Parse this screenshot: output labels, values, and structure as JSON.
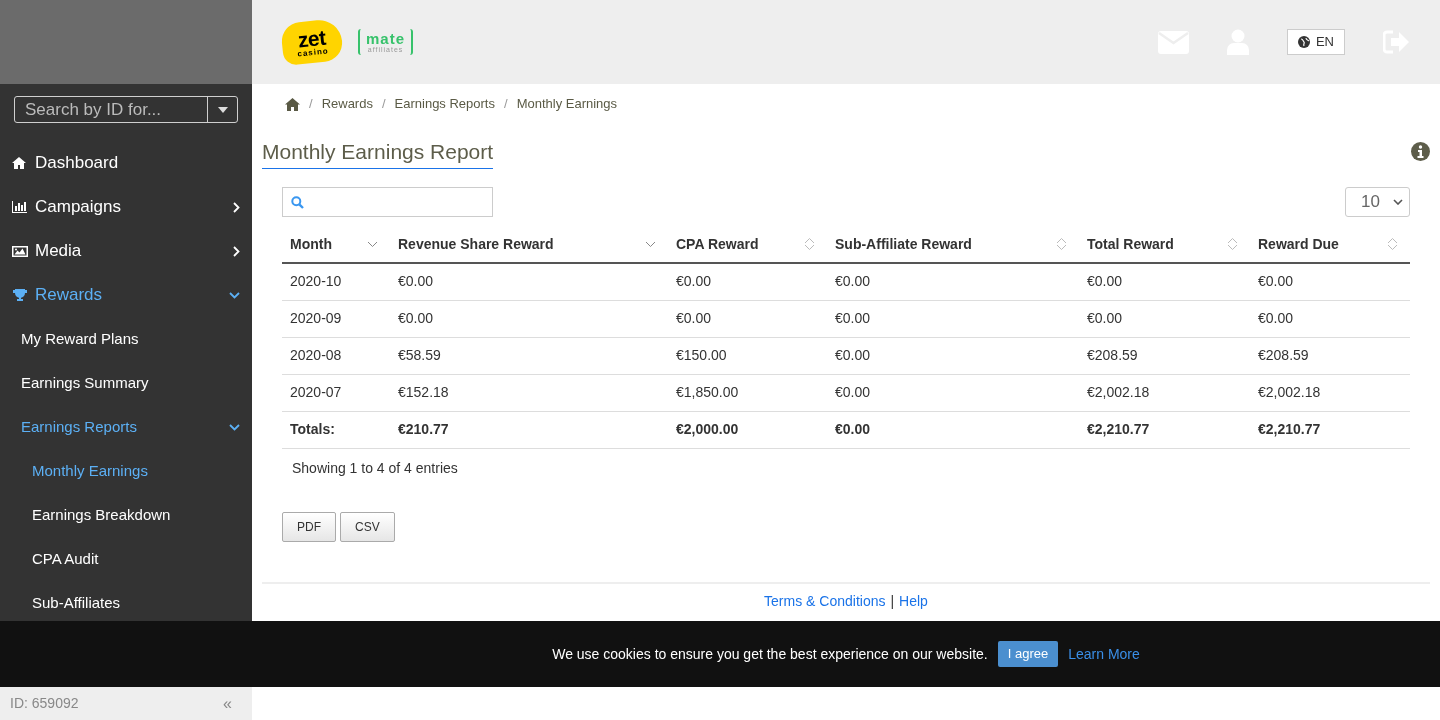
{
  "sidebar": {
    "search": {
      "placeholder": "Search by ID for..."
    },
    "items": [
      {
        "label": "Dashboard",
        "selected": false
      },
      {
        "label": "Campaigns",
        "selected": false,
        "expanded": false
      },
      {
        "label": "Media",
        "selected": false,
        "expanded": false
      },
      {
        "label": "Rewards",
        "selected": true,
        "expanded": true,
        "children": [
          {
            "label": "My Reward Plans",
            "selected": false
          },
          {
            "label": "Earnings Summary",
            "selected": false
          },
          {
            "label": "Earnings Reports",
            "selected": true,
            "expanded": true,
            "children": [
              {
                "label": "Monthly Earnings",
                "selected": true
              },
              {
                "label": "Earnings Breakdown",
                "selected": false
              },
              {
                "label": "CPA Audit",
                "selected": false
              },
              {
                "label": "Sub-Affiliates",
                "selected": false
              }
            ]
          }
        ]
      }
    ],
    "footer": {
      "user_id": "ID: 659092",
      "collapse": "«"
    }
  },
  "header": {
    "logo": {
      "word": "zet",
      "subword": "casino"
    },
    "partner_logo": {
      "word": "mate",
      "subword": "affiliates"
    },
    "language": "EN"
  },
  "breadcrumb": {
    "separator": "/",
    "items": [
      "Rewards",
      "Earnings Reports",
      "Monthly Earnings"
    ]
  },
  "page_title": "Monthly Earnings Report",
  "table_controls": {
    "page_size": "10"
  },
  "table": {
    "columns": [
      {
        "label": "Month",
        "sorted": true
      },
      {
        "label": "Revenue Share Reward",
        "sorted": true
      },
      {
        "label": "CPA Reward",
        "sorted": false
      },
      {
        "label": "Sub-Affiliate Reward",
        "sorted": false
      },
      {
        "label": "Total Reward",
        "sorted": false
      },
      {
        "label": "Reward Due",
        "sorted": false
      }
    ],
    "rows": [
      [
        "2020-10",
        "€0.00",
        "€0.00",
        "€0.00",
        "€0.00",
        "€0.00"
      ],
      [
        "2020-09",
        "€0.00",
        "€0.00",
        "€0.00",
        "€0.00",
        "€0.00"
      ],
      [
        "2020-08",
        "€58.59",
        "€150.00",
        "€0.00",
        "€208.59",
        "€208.59"
      ],
      [
        "2020-07",
        "€152.18",
        "€1,850.00",
        "€0.00",
        "€2,002.18",
        "€2,002.18"
      ]
    ],
    "totals": [
      "Totals:",
      "€210.77",
      "€2,000.00",
      "€0.00",
      "€2,210.77",
      "€2,210.77"
    ]
  },
  "entries_info": "Showing 1 to 4 of 4 entries",
  "export_buttons": [
    "PDF",
    "CSV"
  ],
  "footer": {
    "links": [
      "Terms & Conditions",
      "Help"
    ],
    "separator": "|"
  },
  "cookie_banner": {
    "message": "We use cookies to ensure you get the best experience on our website.",
    "accept": "I agree",
    "learn_more": "Learn More"
  }
}
